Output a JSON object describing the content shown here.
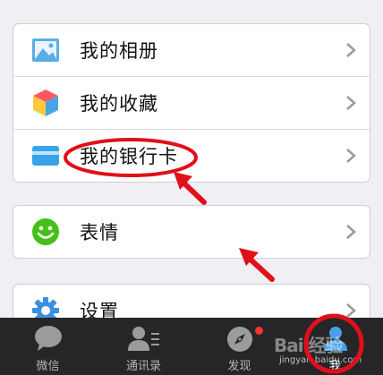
{
  "menu": {
    "group1": [
      {
        "label": "我的相册",
        "icon": "photo-album-icon"
      },
      {
        "label": "我的收藏",
        "icon": "favorites-cube-icon"
      },
      {
        "label": "我的银行卡",
        "icon": "bank-card-icon"
      }
    ],
    "group2": [
      {
        "label": "表情",
        "icon": "smiley-face-icon"
      }
    ],
    "group3": [
      {
        "label": "设置",
        "icon": "settings-gear-icon"
      }
    ]
  },
  "tabbar": {
    "tabs": [
      {
        "label": "微信",
        "icon": "chat-bubble-icon"
      },
      {
        "label": "通讯录",
        "icon": "contacts-icon"
      },
      {
        "label": "发现",
        "icon": "compass-icon"
      },
      {
        "label": "我",
        "icon": "me-person-icon"
      }
    ],
    "active_index": 3
  },
  "watermark": {
    "brand": "Bai 经验",
    "url": "jingyan.baidu.com"
  },
  "colors": {
    "background": "#efeff4",
    "tabbar": "#262628",
    "accent_green": "#45c01a",
    "annotation_red": "#e0101a",
    "badge_red": "#f43530"
  }
}
